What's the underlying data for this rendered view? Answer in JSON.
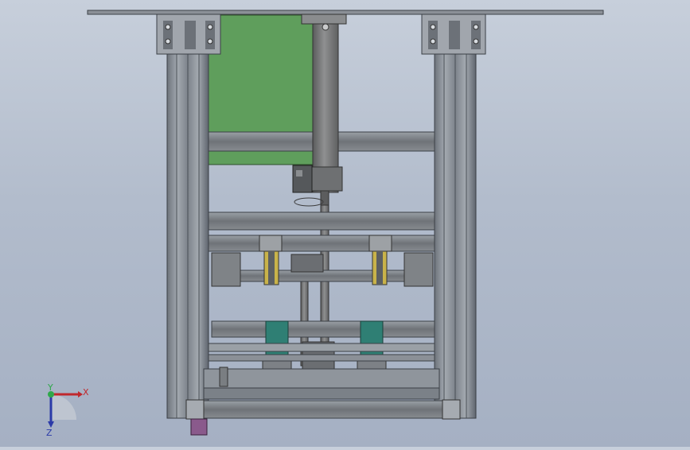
{
  "viewport": {
    "model": "linear-module-frame-assembly",
    "background_top": "#c7cfdb",
    "background_bottom": "#a5b0c3"
  },
  "triad": {
    "x_label": "X",
    "y_label": "Y",
    "z_label": "Z",
    "x_color": "#c0282d",
    "y_color": "#2fa84a",
    "z_color": "#2b3aa8"
  },
  "colors": {
    "profile": "#8e949c",
    "profile_dark": "#5f656e",
    "panel_green": "#5f9e5c",
    "cylinder": "#7b7c7d",
    "bearing_yellow": "#c9b34a",
    "guide_teal": "#2f7f74",
    "purple_part": "#8a5a8c"
  }
}
